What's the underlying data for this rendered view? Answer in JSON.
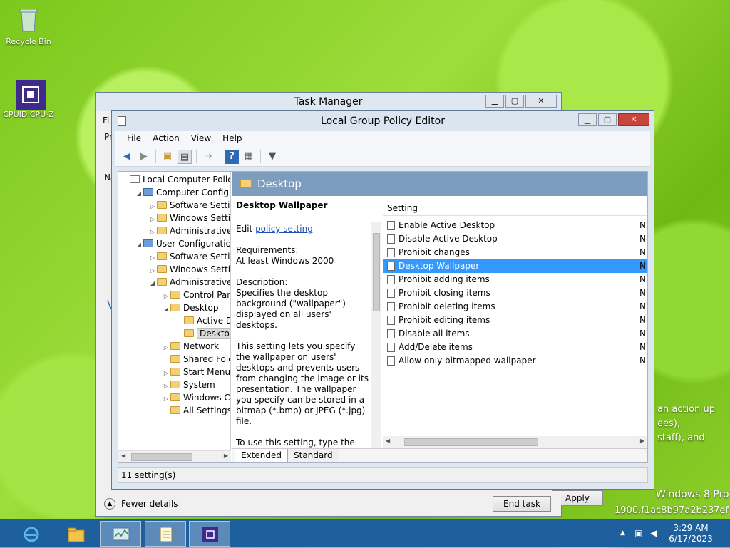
{
  "desktop": {
    "icons": [
      {
        "label": "Recycle Bin"
      },
      {
        "label": "CPUID CPU-Z"
      }
    ],
    "overlay_text": {
      "line1": "an action up",
      "line2": "ees),",
      "line3": "staff), and",
      "watermark1": "Windows 8 Pro",
      "watermark2": "1900.f1ac8b97a2b237ef"
    }
  },
  "task_manager": {
    "title": "Task Manager",
    "menu_fragment": "Fi",
    "tab_fragment": "Pr",
    "fewer_details": "Fewer details",
    "end_task": "End task",
    "apply": "Apply",
    "side_fragments": [
      "Na",
      "V"
    ]
  },
  "gpe": {
    "title": "Local Group Policy Editor",
    "menu": [
      "File",
      "Action",
      "View",
      "Help"
    ],
    "tree": [
      {
        "label": "Local Computer Policy",
        "indent": 0,
        "exp": "",
        "icon": "doc"
      },
      {
        "label": "Computer Configura",
        "indent": 1,
        "exp": "◢",
        "icon": "pc"
      },
      {
        "label": "Software Settings",
        "indent": 2,
        "exp": "▷",
        "icon": "folder"
      },
      {
        "label": "Windows Setting",
        "indent": 2,
        "exp": "▷",
        "icon": "folder"
      },
      {
        "label": "Administrative Te",
        "indent": 2,
        "exp": "▷",
        "icon": "folder"
      },
      {
        "label": "User Configuration",
        "indent": 1,
        "exp": "◢",
        "icon": "pc"
      },
      {
        "label": "Software Settings",
        "indent": 2,
        "exp": "▷",
        "icon": "folder"
      },
      {
        "label": "Windows Setting",
        "indent": 2,
        "exp": "▷",
        "icon": "folder"
      },
      {
        "label": "Administrative Te",
        "indent": 2,
        "exp": "◢",
        "icon": "folder"
      },
      {
        "label": "Control Panel",
        "indent": 3,
        "exp": "▷",
        "icon": "folder"
      },
      {
        "label": "Desktop",
        "indent": 3,
        "exp": "◢",
        "icon": "folder"
      },
      {
        "label": "Active Dir",
        "indent": 4,
        "exp": "",
        "icon": "folder"
      },
      {
        "label": "Desktop",
        "indent": 4,
        "exp": "",
        "icon": "folder",
        "selected": true
      },
      {
        "label": "Network",
        "indent": 3,
        "exp": "▷",
        "icon": "folder"
      },
      {
        "label": "Shared Folder",
        "indent": 3,
        "exp": "",
        "icon": "folder"
      },
      {
        "label": "Start Menu ar",
        "indent": 3,
        "exp": "▷",
        "icon": "folder"
      },
      {
        "label": "System",
        "indent": 3,
        "exp": "▷",
        "icon": "folder"
      },
      {
        "label": "Windows Cor",
        "indent": 3,
        "exp": "▷",
        "icon": "folder"
      },
      {
        "label": "All Settings",
        "indent": 3,
        "exp": "",
        "icon": "folder"
      }
    ],
    "header": "Desktop",
    "description": {
      "title": "Desktop Wallpaper",
      "edit_prefix": "Edit ",
      "edit_link": "policy setting ",
      "requirements_label": "Requirements:",
      "requirements_value": "At least Windows 2000",
      "description_label": "Description:",
      "description_text": "Specifies the desktop background (\"wallpaper\") displayed on all users' desktops.",
      "para2": "This setting lets you specify the wallpaper on users' desktops and prevents users from changing the image or its presentation. The wallpaper you specify can be stored in a bitmap (*.bmp) or JPEG (*.jpg) file.",
      "para3": "To use this setting, type the fully qualified path and name of the file that stores the wallpaper image."
    },
    "column_header": "Setting",
    "settings": [
      {
        "name": "Enable Active Desktop",
        "state": "N"
      },
      {
        "name": "Disable Active Desktop",
        "state": "N"
      },
      {
        "name": "Prohibit changes",
        "state": "N"
      },
      {
        "name": "Desktop Wallpaper",
        "state": "N",
        "selected": true
      },
      {
        "name": "Prohibit adding items",
        "state": "N"
      },
      {
        "name": "Prohibit closing items",
        "state": "N"
      },
      {
        "name": "Prohibit deleting items",
        "state": "N"
      },
      {
        "name": "Prohibit editing items",
        "state": "N"
      },
      {
        "name": "Disable all items",
        "state": "N"
      },
      {
        "name": "Add/Delete items",
        "state": "N"
      },
      {
        "name": "Allow only bitmapped wallpaper",
        "state": "N"
      }
    ],
    "tabs": [
      "Extended",
      "Standard"
    ],
    "status": "11 setting(s)"
  },
  "taskbar": {
    "time": "3:29 AM",
    "date": "6/17/2023"
  }
}
